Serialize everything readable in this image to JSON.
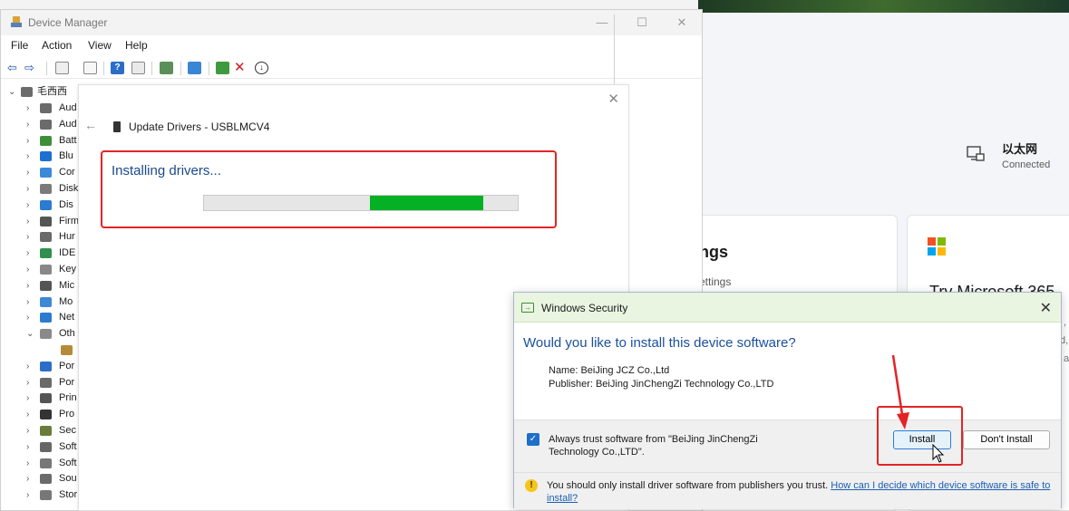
{
  "device_manager": {
    "title": "Device Manager",
    "menu": [
      "File",
      "Action",
      "View",
      "Help"
    ],
    "tree": {
      "root": "毛西西",
      "items": [
        {
          "label": "Aud",
          "color": "#6b6b6b",
          "expanded": false
        },
        {
          "label": "Aud",
          "color": "#6b6b6b",
          "expanded": false
        },
        {
          "label": "Batt",
          "color": "#3f8f3a",
          "expanded": false
        },
        {
          "label": "Blu",
          "color": "#1d6fd1",
          "expanded": false
        },
        {
          "label": "Cor",
          "color": "#3b8ad8",
          "expanded": false
        },
        {
          "label": "Disk",
          "color": "#7a7a7a",
          "expanded": false
        },
        {
          "label": "Dis",
          "color": "#2b7bd0",
          "expanded": false
        },
        {
          "label": "Firm",
          "color": "#555555",
          "expanded": false
        },
        {
          "label": "Hur",
          "color": "#6a6a6a",
          "expanded": false
        },
        {
          "label": "IDE",
          "color": "#2f8f4e",
          "expanded": false
        },
        {
          "label": "Key",
          "color": "#888888",
          "expanded": false
        },
        {
          "label": "Mic",
          "color": "#555555",
          "expanded": false
        },
        {
          "label": "Mo",
          "color": "#3e89d6",
          "expanded": false
        },
        {
          "label": "Net",
          "color": "#2b7bd0",
          "expanded": false
        },
        {
          "label": "Oth",
          "color": "#8a8a8a",
          "expanded": true
        },
        {
          "label": "",
          "color": "#b58a3a",
          "expanded": null
        },
        {
          "label": "Por",
          "color": "#2b6ec9",
          "expanded": false
        },
        {
          "label": "Por",
          "color": "#6a6a6a",
          "expanded": false
        },
        {
          "label": "Prin",
          "color": "#555555",
          "expanded": false
        },
        {
          "label": "Pro",
          "color": "#333333",
          "expanded": false
        },
        {
          "label": "Sec",
          "color": "#6b7b3a",
          "expanded": false
        },
        {
          "label": "Soft",
          "color": "#666666",
          "expanded": false
        },
        {
          "label": "Soft",
          "color": "#777777",
          "expanded": false
        },
        {
          "label": "Sou",
          "color": "#6b6b6b",
          "expanded": false
        },
        {
          "label": "Stor",
          "color": "#777777",
          "expanded": false
        }
      ]
    }
  },
  "update_drivers": {
    "title": "Update Drivers - USBLMCV4",
    "status": "Installing drivers...",
    "progress": {
      "start": 0.53,
      "end": 0.89
    }
  },
  "settings_background": {
    "ethernet_name": "以太网",
    "ethernet_status": "Connected",
    "card1_title": "ngs",
    "card1_sub": "ettings",
    "card2_title": "Try Microsoft 365",
    "card2_fragments": [
      ", a",
      "d,",
      "al"
    ]
  },
  "security_dialog": {
    "title": "Windows Security",
    "question": "Would you like to install this device software?",
    "name": "Name: BeiJing JCZ Co.,Ltd",
    "publisher": "Publisher: BeiJing JinChengZi Technology Co.,LTD",
    "always_trust": "Always trust software from \"BeiJing JinChengZi Technology Co.,LTD\".",
    "always_trust_checked": true,
    "install_label": "Install",
    "dont_install_label": "Don't Install",
    "warning": "You should only install driver software from publishers you trust.",
    "warning_link": "How can I decide which device software is safe to install?"
  },
  "colors": {
    "highlight": "#e32424",
    "progress": "#06b025",
    "link": "#1a5fb4"
  }
}
